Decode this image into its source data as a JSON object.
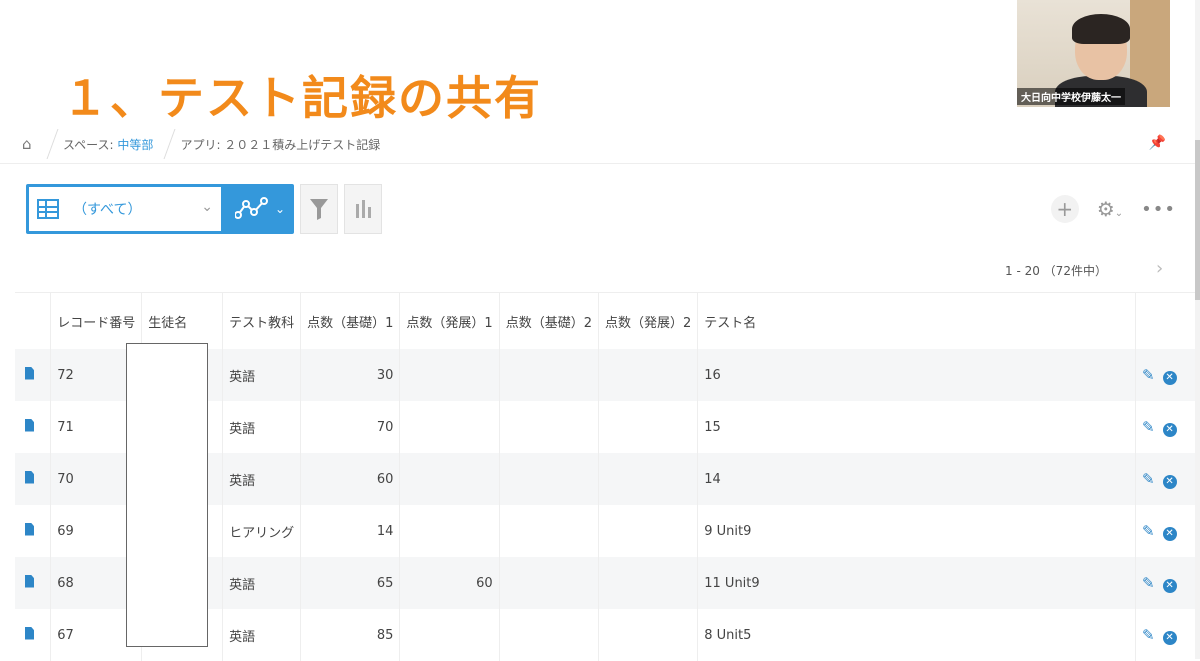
{
  "slide": {
    "title": "１、テスト記録の共有"
  },
  "webcam": {
    "name": "大日向中学校伊藤太一"
  },
  "breadcrumb": {
    "space_prefix": "スペース: ",
    "space_link": "中等部",
    "app": "アプリ: ２０２１積み上げテスト記録"
  },
  "toolbar": {
    "view_label": "（すべて）"
  },
  "pager": {
    "text": "1 - 20 （72件中）"
  },
  "table": {
    "headers": [
      "レコード番号",
      "生徒名",
      "テスト教科",
      "点数（基礎）1",
      "点数（発展）1",
      "点数（基礎）2",
      "点数（発展）2",
      "テスト名"
    ],
    "rows": [
      {
        "id": "72",
        "name": "",
        "subject": "英語",
        "b1": "30",
        "a1": "",
        "b2": "",
        "a2": "",
        "test": "16"
      },
      {
        "id": "71",
        "name": "",
        "subject": "英語",
        "b1": "70",
        "a1": "",
        "b2": "",
        "a2": "",
        "test": "15"
      },
      {
        "id": "70",
        "name": "",
        "subject": "英語",
        "b1": "60",
        "a1": "",
        "b2": "",
        "a2": "",
        "test": "14"
      },
      {
        "id": "69",
        "name": "",
        "subject": "ヒアリング",
        "b1": "14",
        "a1": "",
        "b2": "",
        "a2": "",
        "test": "9 Unit9"
      },
      {
        "id": "68",
        "name": "",
        "subject": "英語",
        "b1": "65",
        "a1": "60",
        "b2": "",
        "a2": "",
        "test": "11 Unit9"
      },
      {
        "id": "67",
        "name": "",
        "subject": "英語",
        "b1": "85",
        "a1": "",
        "b2": "",
        "a2": "",
        "test": "8 Unit5"
      }
    ]
  },
  "colors": {
    "accent": "#3498db",
    "title": "#f28a1b",
    "icon": "#2d86c7"
  }
}
